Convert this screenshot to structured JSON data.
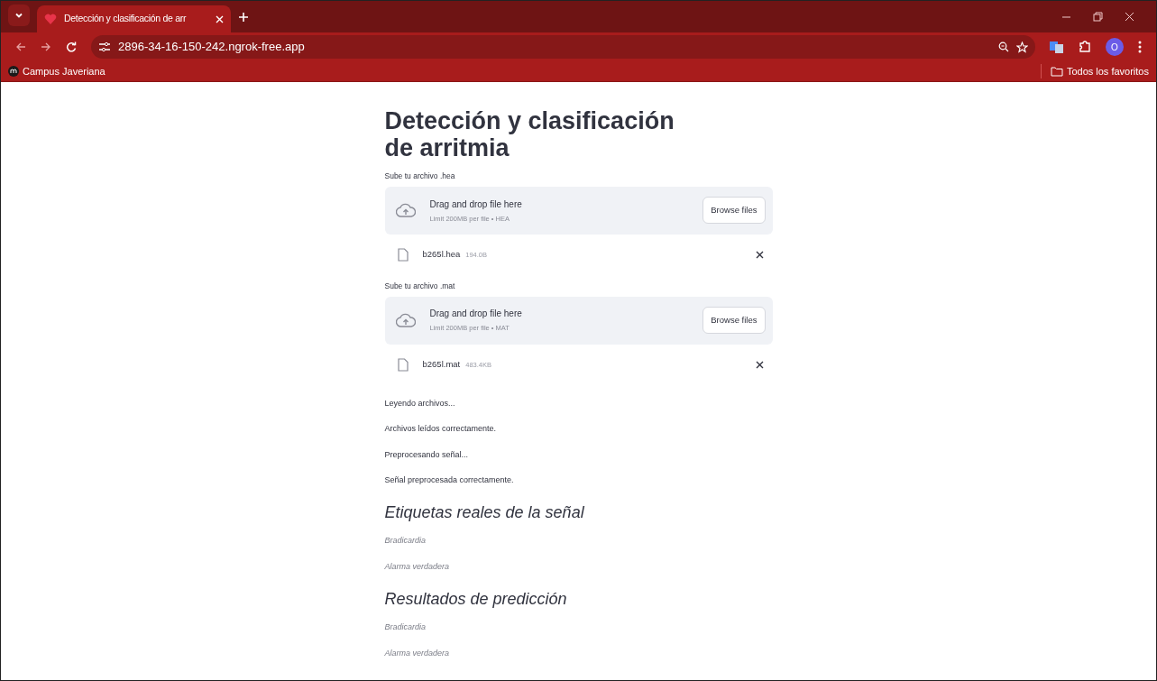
{
  "browser": {
    "tab": {
      "title": "Detección y clasificación de arr",
      "selected": true
    },
    "url": "2896-34-16-150-242.ngrok-free.app",
    "profile_initial": "O",
    "bookmarks": [
      {
        "label": "Campus Javeriana",
        "kind": "site"
      },
      {
        "label": "Todos los favoritos",
        "kind": "folder"
      }
    ]
  },
  "page": {
    "title": "Detección y clasificación de arritmia",
    "uploaders": [
      {
        "label": "Sube tu archivo .hea",
        "dropzone_text": "Drag and drop file here",
        "limit_text": "Limit 200MB per file • HEA",
        "button": "Browse files",
        "file": {
          "name": "b265l.hea",
          "size": "194.0B"
        }
      },
      {
        "label": "Sube tu archivo .mat",
        "dropzone_text": "Drag and drop file here",
        "limit_text": "Limit 200MB per file • MAT",
        "button": "Browse files",
        "file": {
          "name": "b265l.mat",
          "size": "483.4KB"
        }
      }
    ],
    "messages": [
      "Leyendo archivos...",
      "Archivos leídos correctamente.",
      "Preprocesando señal...",
      "Señal preprocesada correctamente."
    ],
    "sections": [
      {
        "heading": "Etiquetas reales de la señal",
        "items": [
          "Bradicardia",
          "Alarma verdadera"
        ]
      },
      {
        "heading": "Resultados de predicción",
        "items": [
          "Bradicardia",
          "Alarma verdadera"
        ]
      }
    ]
  }
}
